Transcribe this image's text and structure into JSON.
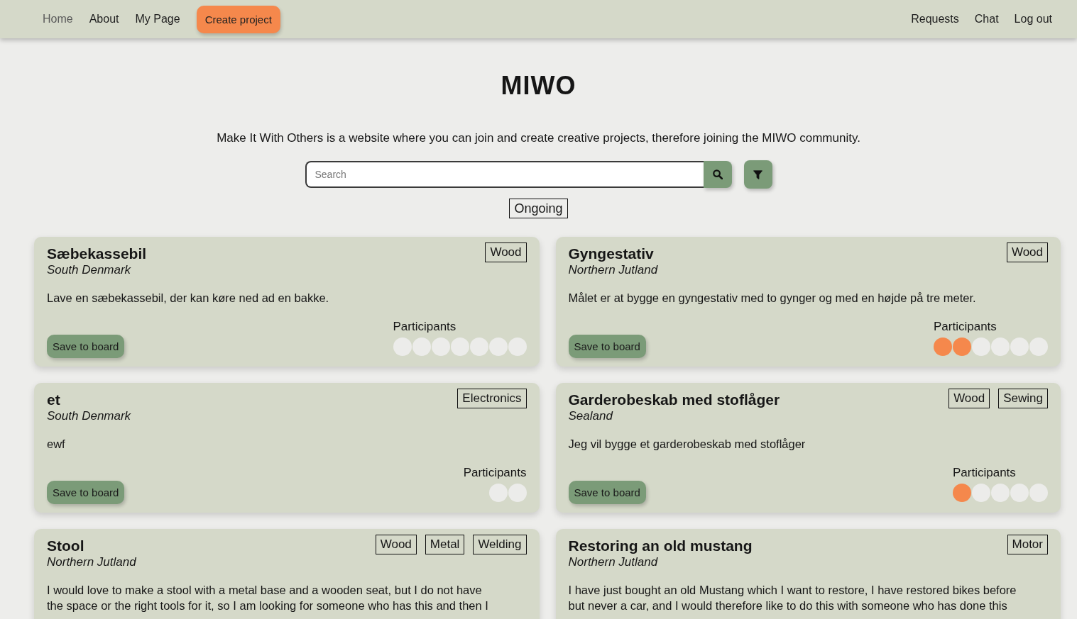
{
  "nav": {
    "left": [
      {
        "label": "Home",
        "kind": "link",
        "selected": true
      },
      {
        "label": "About",
        "kind": "link",
        "selected": false
      },
      {
        "label": "My Page",
        "kind": "link",
        "selected": false
      },
      {
        "label": "Create project",
        "kind": "button",
        "selected": false
      }
    ],
    "right": [
      {
        "label": "Requests",
        "kind": "link",
        "selected": false
      },
      {
        "label": "Chat",
        "kind": "link",
        "selected": false
      },
      {
        "label": "Log out",
        "kind": "link",
        "selected": false
      }
    ]
  },
  "header": {
    "title": "MIWO",
    "subtitle": "Make It With Others is a website where you can join and create creative projects, therefore joining the MIWO community."
  },
  "search": {
    "placeholder": "Search"
  },
  "filters": [
    {
      "label": "Ongoing"
    }
  ],
  "projects": [
    {
      "title": "Sæbekassebil",
      "region": "South Denmark",
      "tags": [
        "Wood"
      ],
      "description": "Lave en sæbekassebil, der kan køre ned ad en bakke.",
      "save_button": "Save to board",
      "participants": {
        "label": "Participants",
        "slots": [
          {
            "filled": false
          },
          {
            "filled": false
          },
          {
            "filled": false
          },
          {
            "filled": false
          },
          {
            "filled": false
          },
          {
            "filled": false
          },
          {
            "filled": false
          }
        ]
      }
    },
    {
      "title": "Gyngestativ",
      "region": "Northern Jutland",
      "tags": [
        "Wood"
      ],
      "description": "Målet er at bygge en gyngestativ med to gynger og med en højde på tre meter.",
      "save_button": "Save to board",
      "participants": {
        "label": "Participants",
        "slots": [
          {
            "filled": true
          },
          {
            "filled": true
          },
          {
            "filled": false
          },
          {
            "filled": false
          },
          {
            "filled": false
          },
          {
            "filled": false
          }
        ]
      }
    },
    {
      "title": "et",
      "region": "South Denmark",
      "tags": [
        "Electronics"
      ],
      "description": "ewf",
      "save_button": "Save to board",
      "participants": {
        "label": "Participants",
        "slots": [
          {
            "filled": false
          },
          {
            "filled": false
          }
        ]
      }
    },
    {
      "title": "Garderobeskab med stoflåger",
      "region": "Sealand",
      "tags": [
        "Wood",
        "Sewing"
      ],
      "description": "Jeg vil bygge et garderobeskab med stoflåger",
      "save_button": "Save to board",
      "participants": {
        "label": "Participants",
        "slots": [
          {
            "filled": true
          },
          {
            "filled": false
          },
          {
            "filled": false
          },
          {
            "filled": false
          },
          {
            "filled": false
          }
        ]
      }
    },
    {
      "title": "Stool",
      "region": "Northern Jutland",
      "tags": [
        "Wood",
        "Metal",
        "Welding"
      ],
      "description": "I would love to make a stool with a metal base and a wooden seat, but I do not have\nthe space or the right tools for it, so I am looking for someone who has this and then I"
    },
    {
      "title": "Restoring an old mustang",
      "region": "Northern Jutland",
      "tags": [
        "Motor"
      ],
      "description": "I have just bought an old Mustang which I want to restore, I have restored bikes before\nbut never a car, and I would therefore like to do this with someone who has done this"
    }
  ]
}
